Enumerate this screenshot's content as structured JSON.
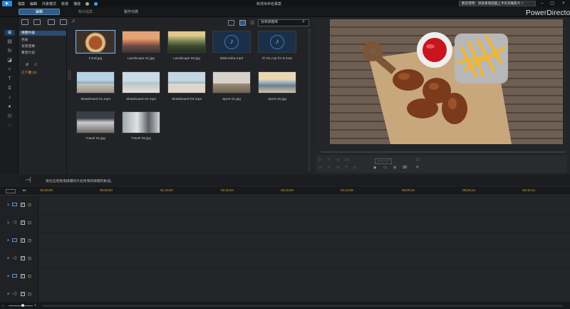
{
  "app": {
    "brand": "PowerDirector",
    "project_title": "新增未命名專案"
  },
  "menu": [
    "檔案",
    "編輯",
    "外掛模式",
    "檢視",
    "播放"
  ],
  "notice": "歡迎使用：探索看看超酷上手的剪輯影片 ×",
  "modes": {
    "edit": "編輯",
    "output": "輸出檔案",
    "disc": "製作光碟"
  },
  "library": {
    "tree": [
      "媒體內容",
      "色板",
      "背景音樂",
      "聲音片段"
    ],
    "downloads": "已下載 (0)",
    "search_placeholder": "搜尋媒體庫",
    "items": [
      {
        "name": "Food.jpg",
        "kind": "image",
        "selected": true
      },
      {
        "name": "Landscape 01.jpg",
        "kind": "image"
      },
      {
        "name": "Landscape 02.jpg",
        "kind": "image"
      },
      {
        "name": "Mahoroba.mp3",
        "kind": "audio"
      },
      {
        "name": "Ill You Up for It.m4a",
        "kind": "audio"
      },
      {
        "name": "Skateboard 01.mp4",
        "kind": "video"
      },
      {
        "name": "Skateboard 02.mp4",
        "kind": "video"
      },
      {
        "name": "Skateboard 03.mp4",
        "kind": "video"
      },
      {
        "name": "Sport 01.jpg",
        "kind": "image"
      },
      {
        "name": "Sport 02.jpg",
        "kind": "image"
      },
      {
        "name": "Travel 01.jpg",
        "kind": "image"
      },
      {
        "name": "Travel 02.jpg",
        "kind": "image"
      }
    ]
  },
  "preview": {
    "timecode": "--;--;--;--",
    "zoom": "3D"
  },
  "timeline": {
    "hint": "按住這或拖曳媒體的片段拖曳到媒體的軌道。",
    "ticks": [
      "00;00;00",
      "00;50;00",
      "01;40;02",
      "02;30;04",
      "03;20;06",
      "04;10;08",
      "05;00;10",
      "05;50;12",
      "06;40;12"
    ],
    "tracks": [
      {
        "num": "1.",
        "kind": "video"
      },
      {
        "num": "1.",
        "kind": "audio"
      },
      {
        "num": "2.",
        "kind": "video"
      },
      {
        "num": "2.",
        "kind": "audio"
      },
      {
        "num": "3.",
        "kind": "video"
      },
      {
        "num": "3.",
        "kind": "audio"
      }
    ]
  },
  "colors": {
    "accent": "#2f5d8a",
    "timecode": "#d6a23a"
  }
}
